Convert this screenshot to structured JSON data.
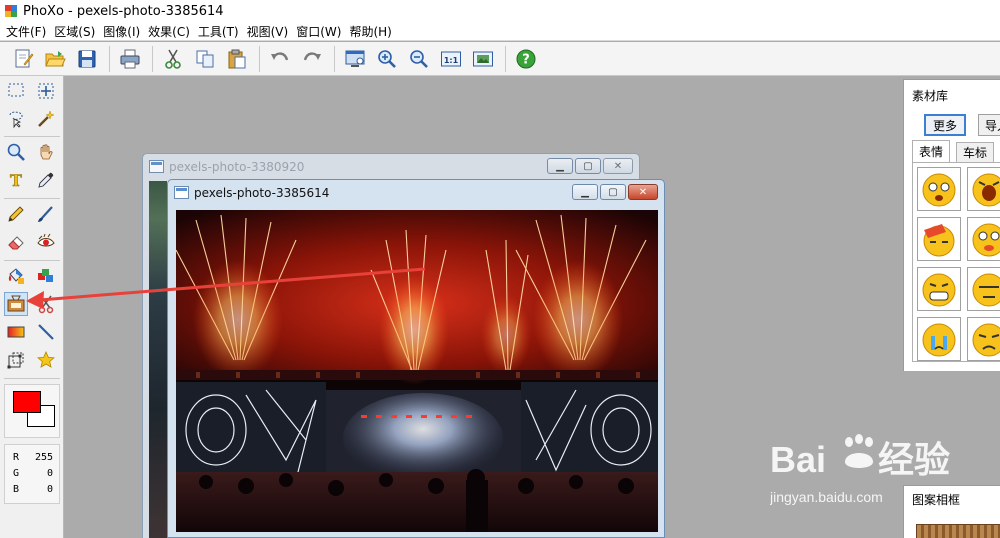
{
  "window": {
    "title": "PhoXo - pexels-photo-3385614"
  },
  "menu": [
    {
      "label": "文件(F)"
    },
    {
      "label": "区域(S)"
    },
    {
      "label": "图像(I)"
    },
    {
      "label": "效果(C)"
    },
    {
      "label": "工具(T)"
    },
    {
      "label": "视图(V)"
    },
    {
      "label": "窗口(W)"
    },
    {
      "label": "帮助(H)"
    }
  ],
  "toolbar": {
    "icons": [
      "new-icon",
      "open-icon",
      "save-icon",
      "print-icon",
      "cut-icon",
      "copy-icon",
      "paste-icon",
      "undo-icon",
      "redo-icon",
      "screen-capture-icon",
      "zoom-in-icon",
      "zoom-out-icon",
      "actual-size-icon",
      "fit-window-icon",
      "help-icon"
    ],
    "actual_size_label": "1:1"
  },
  "tools": {
    "active": "frame-tool",
    "icons": [
      "rect-select-icon",
      "move-icon",
      "lasso-icon",
      "magic-wand-icon",
      "zoom-icon",
      "hand-icon",
      "text-icon",
      "eyedropper-icon",
      "pencil-icon",
      "brush-icon",
      "eraser-icon",
      "red-eye-icon",
      "fill-icon",
      "color-replace-icon",
      "frame-icon",
      "clone-icon",
      "gradient-icon",
      "line-icon",
      "transform-icon",
      "star-icon"
    ]
  },
  "colors": {
    "foreground": "#ff0000",
    "background": "#ffffff",
    "accent": "#3c7fd0"
  },
  "rgb": {
    "r_label": "R",
    "r_value": "255",
    "g_label": "G",
    "g_value": "0",
    "b_label": "B",
    "b_value": "0"
  },
  "documents": {
    "back_title": "pexels-photo-3380920",
    "front_title": "pexels-photo-3385614"
  },
  "material_panel": {
    "title": "素材库",
    "more_button": "更多",
    "import_button": "导入",
    "tabs": [
      "表情",
      "车标"
    ],
    "active_tab": "表情"
  },
  "frame_panel": {
    "title": "图案相框"
  },
  "watermark": {
    "logo": "Bai du 经验",
    "url": "jingyan.baidu.com"
  }
}
